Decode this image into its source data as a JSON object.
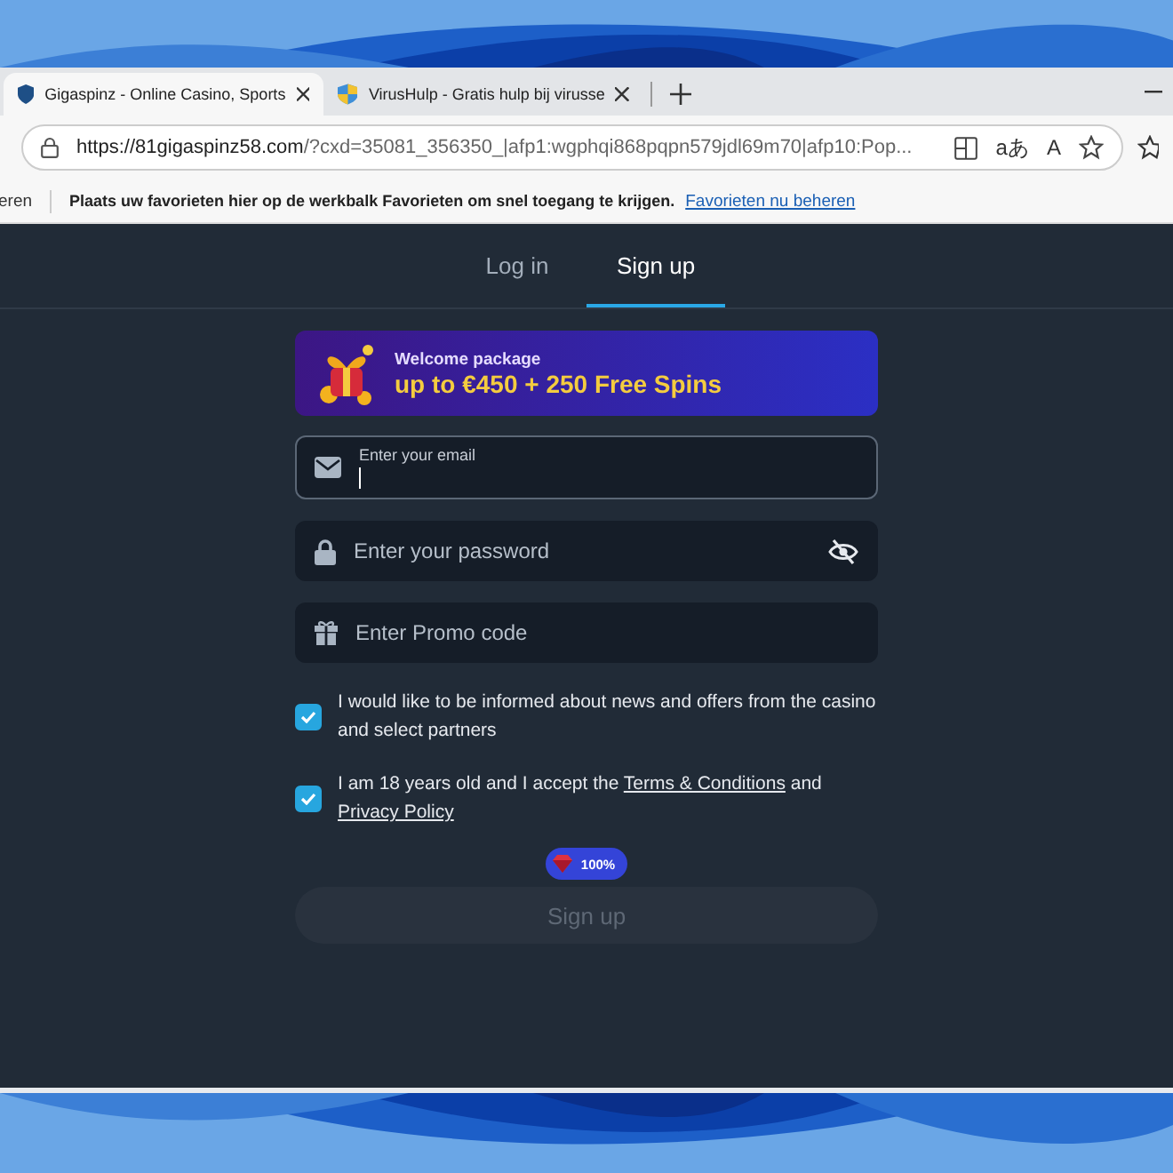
{
  "browser": {
    "tabs": [
      {
        "title": "Gigaspinz - Online Casino, Sports",
        "selected": true
      },
      {
        "title": "VirusHulp - Gratis hulp bij virusse",
        "selected": false
      }
    ],
    "address_bar": {
      "url_host": "https://81gigaspinz58.com",
      "url_rest": "/?cxd=35081_356350_|afp1:wgphqi868pqpn579jdl69m70|afp10:Pop...",
      "translate_glyph": "aあ",
      "read_aloud_glyph": "A"
    },
    "favorites_bar": {
      "cut_item": "eren",
      "message": "Plaats uw favorieten hier op de werkbalk Favorieten om snel toegang te krijgen.",
      "link": "Favorieten nu beheren"
    }
  },
  "page": {
    "tabs": [
      {
        "label": "Log in",
        "selected": false
      },
      {
        "label": "Sign up",
        "selected": true
      }
    ],
    "promo": {
      "title": "Welcome package",
      "headline": "up to €450 + 250 Free Spins"
    },
    "fields": [
      {
        "kind": "email",
        "label": "Enter your email",
        "focused": true
      },
      {
        "kind": "password",
        "placeholder": "Enter your password",
        "focused": false
      },
      {
        "kind": "promo",
        "placeholder": "Enter Promo code",
        "focused": false
      }
    ],
    "consents": [
      {
        "checked": true,
        "parts": [
          {
            "kind": "text",
            "text": "I would like to be informed about news and offers from the casino and select partners"
          }
        ]
      },
      {
        "checked": true,
        "parts": [
          {
            "kind": "text",
            "text": "I am 18 years old and I accept the "
          },
          {
            "kind": "link",
            "text": "Terms & Conditions"
          },
          {
            "kind": "text",
            "text": " and "
          },
          {
            "kind": "link",
            "text": "Privacy Policy"
          }
        ]
      }
    ],
    "badge": "100%",
    "submit": {
      "label": "Sign up",
      "disabled": true
    }
  }
}
